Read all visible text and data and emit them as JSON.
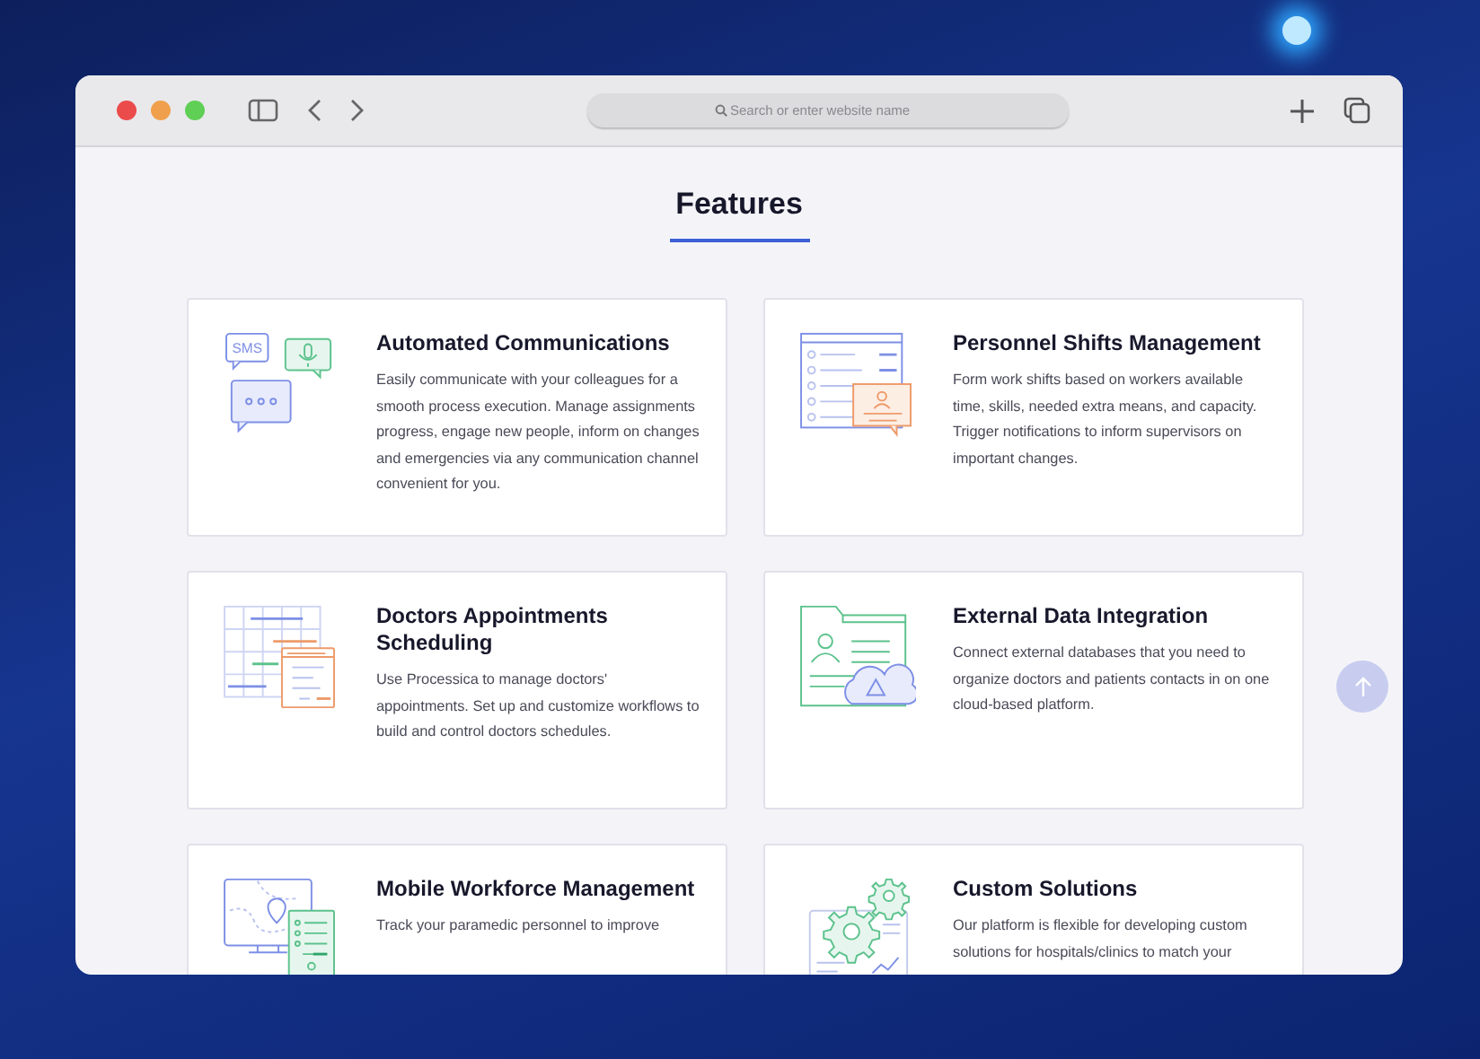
{
  "browser": {
    "address_placeholder": "Search or enter website name"
  },
  "page": {
    "heading": "Features",
    "features": [
      {
        "title": "Automated Communications",
        "icon_label": "SMS",
        "description": "Easily communicate with your colleagues for a smooth process execution. Manage assignments progress, engage new people, inform on changes and emergencies via any communication channel convenient for you."
      },
      {
        "title": "Personnel Shifts Management",
        "description": "Form work shifts based on workers available time, skills, needed extra means, and capacity. Trigger notifications to inform supervisors on important changes."
      },
      {
        "title": "Doctors Appointments Scheduling",
        "description": "Use Processica to manage doctors' appointments. Set up and customize workflows to build and control doctors schedules."
      },
      {
        "title": "External Data Integration",
        "description": "Connect external databases that you need to organize doctors and patients contacts in on one cloud-based platform."
      },
      {
        "title": "Mobile Workforce Management",
        "description": "Track your paramedic personnel to improve"
      },
      {
        "title": "Custom Solutions",
        "description": "Our platform is flexible for developing custom solutions for hospitals/clinics to match your"
      }
    ]
  }
}
